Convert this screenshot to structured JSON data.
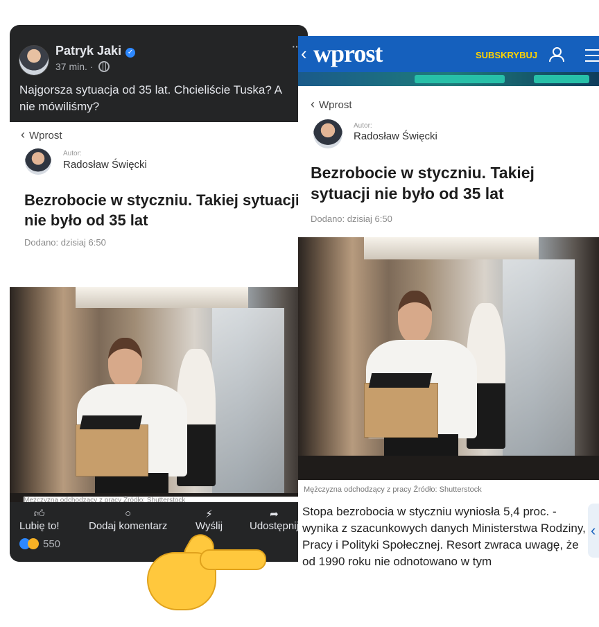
{
  "facebook": {
    "author": "Patryk Jaki",
    "time": "37 min.",
    "separator": "·",
    "more": "···",
    "post_text": "Najgorsza sytuacja od 35 lat. Chcieliście Tuska? A nie mówiliśmy?",
    "actions": {
      "like": "Lubię to!",
      "comment": "Dodaj komentarz",
      "send": "Wyślij",
      "share": "Udostępnij"
    },
    "reaction_count": "550",
    "icons": {
      "like": "thumbs-up-icon",
      "comment": "comment-icon",
      "send": "messenger-icon",
      "share": "share-icon",
      "verified": "verified-badge-icon",
      "audience": "globe-icon"
    }
  },
  "article": {
    "back_label": "Wprost",
    "author_label": "Autor:",
    "author": "Radosław Święcki",
    "title": "Bezrobocie w styczniu. Takiej sytuacji nie było od 35 lat",
    "date": "Dodano: dzisiaj 6:50",
    "caption": "Mężczyzna odchodzący z pracy Źródło: Shutterstock",
    "body": "Stopa bezrobocia w styczniu wyniosła 5,4 proc. - wynika z szacunkowych danych Ministerstwa Rodziny, Pracy i Polityki Społecznej. Resort zwraca uwagę, że od 1990 roku nie odnotowano w tym"
  },
  "wprost": {
    "logo": "wprost",
    "subscribe": "SUBSKRYBUJ",
    "brand_color": "#1560bd",
    "subscribe_color": "#ffd200"
  }
}
